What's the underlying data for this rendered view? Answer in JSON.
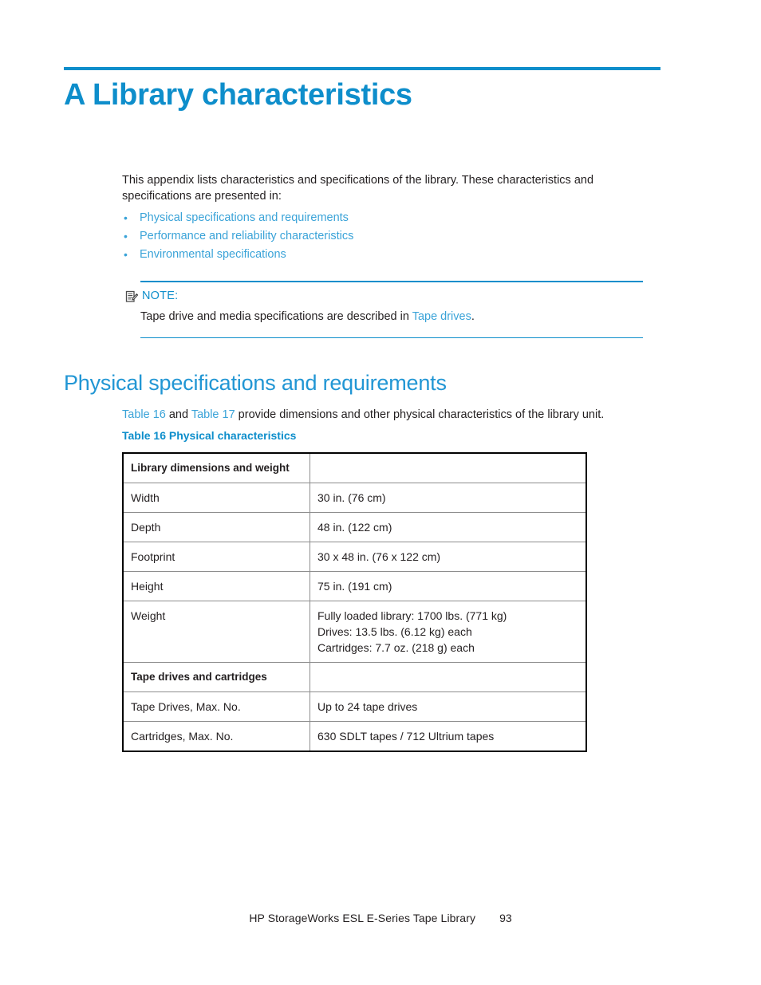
{
  "chapter": {
    "title": "A Library characteristics"
  },
  "intro": {
    "paragraph": "This appendix lists characteristics and specifications of the library. These characteristics and specifications are presented in:"
  },
  "bullets": {
    "marker": "•",
    "items": [
      {
        "label": "Physical specifications and requirements"
      },
      {
        "label": "Performance and reliability characteristics"
      },
      {
        "label": "Environmental specifications"
      }
    ]
  },
  "note": {
    "icon": "note-pencil-icon",
    "label": "NOTE:",
    "body_before": "Tape drive and media specifications are described in ",
    "body_link": "Tape drives",
    "body_after": "."
  },
  "section": {
    "heading": "Physical specifications and requirements",
    "lead_link_1": "Table 16",
    "lead_mid": " and ",
    "lead_link_2": "Table 17",
    "lead_after": " provide dimensions and other physical characteristics of the library unit.",
    "table_caption": "Table 16 Physical characteristics"
  },
  "table": {
    "rows": [
      {
        "type": "group",
        "c1": "Library dimensions and weight",
        "c2": ""
      },
      {
        "type": "data",
        "c1": "Width",
        "c2": "30 in. (76 cm)"
      },
      {
        "type": "data",
        "c1": "Depth",
        "c2": "48 in. (122 cm)"
      },
      {
        "type": "data",
        "c1": "Footprint",
        "c2": "30 x 48 in. (76 x 122 cm)"
      },
      {
        "type": "data",
        "c1": "Height",
        "c2": "75 in. (191 cm)"
      },
      {
        "type": "data-multi",
        "c1": "Weight",
        "c2_lines": [
          "Fully loaded library: 1700 lbs. (771 kg)",
          "Drives: 13.5 lbs. (6.12 kg) each",
          "Cartridges: 7.7 oz. (218 g) each"
        ]
      },
      {
        "type": "group",
        "c1": "Tape drives and cartridges",
        "c2": ""
      },
      {
        "type": "data",
        "c1": "Tape Drives, Max. No.",
        "c2": "Up to 24 tape drives"
      },
      {
        "type": "data",
        "c1": "Cartridges, Max. No.",
        "c2": "630 SDLT tapes / 712 Ultrium tapes"
      }
    ]
  },
  "footer": {
    "text": "HP StorageWorks ESL E-Series Tape Library",
    "page_number": "93"
  },
  "colors": {
    "accent_blue": "#0e8ecb",
    "link_blue": "#3aa3d8",
    "heading_blue": "#2196d4",
    "body_black": "#231f20",
    "table_border": "#000000",
    "table_rule": "#8d8d8d"
  }
}
